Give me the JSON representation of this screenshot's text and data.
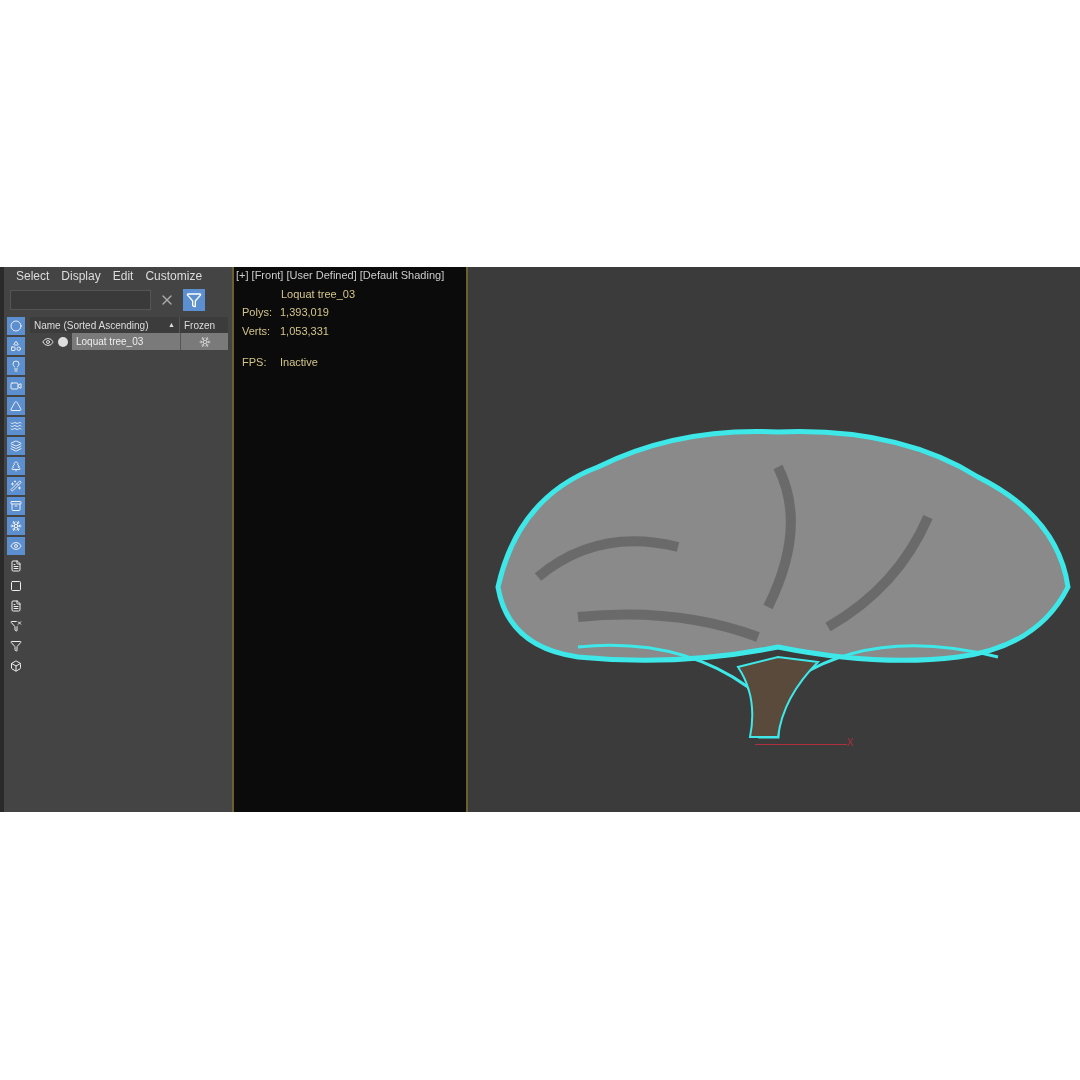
{
  "scene_explorer": {
    "menu": [
      "Select",
      "Display",
      "Edit",
      "Customize"
    ],
    "filter_button": {
      "selected": true
    },
    "side_tools": [
      {
        "kind": "sphere",
        "selected": true
      },
      {
        "kind": "shapes",
        "selected": true
      },
      {
        "kind": "light",
        "selected": true
      },
      {
        "kind": "camera",
        "selected": true
      },
      {
        "kind": "helper",
        "selected": true
      },
      {
        "kind": "waves",
        "selected": true
      },
      {
        "kind": "layers",
        "selected": true
      },
      {
        "kind": "tree",
        "selected": true
      },
      {
        "kind": "bone",
        "selected": true
      },
      {
        "kind": "container",
        "selected": true
      },
      {
        "kind": "frozen",
        "selected": true
      },
      {
        "kind": "eye",
        "selected": true
      },
      {
        "kind": "doc",
        "selected": false
      },
      {
        "kind": "square",
        "selected": false
      },
      {
        "kind": "doc",
        "selected": false
      },
      {
        "kind": "filter-gear",
        "selected": false
      },
      {
        "kind": "filter",
        "selected": false
      },
      {
        "kind": "box",
        "selected": false
      }
    ],
    "columns": [
      {
        "label": "Name (Sorted Ascending)",
        "sort": "▲"
      },
      {
        "label": "Frozen"
      }
    ],
    "rows": [
      {
        "name": "Loquat tree_03",
        "visible": true,
        "selected": true,
        "frozen": true
      }
    ]
  },
  "viewport": {
    "label": "[+] [Front] [User Defined] [Default Shading]",
    "stats": {
      "object": "Loquat tree_03",
      "lines": [
        {
          "label": "Polys:",
          "value": "1,393,019"
        },
        {
          "label": "Verts:",
          "value": "1,053,331"
        },
        {
          "label": "FPS:",
          "value": "Inactive",
          "gap": true
        }
      ]
    },
    "axis_label": "X"
  }
}
